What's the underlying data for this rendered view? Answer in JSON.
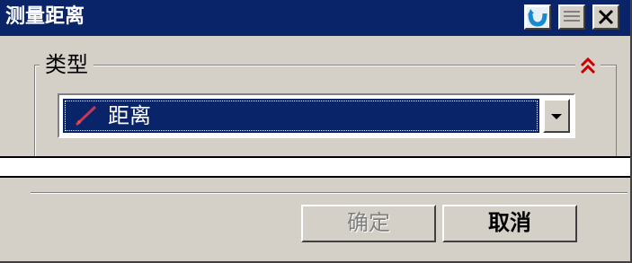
{
  "window": {
    "title": "测量距离",
    "colors": {
      "titlebar": "#0a246a",
      "face": "#d4d0c8",
      "selection": "#0a246a",
      "collapse_accent": "#cc0000"
    }
  },
  "titlebar_buttons": {
    "reset_icon": "reset-icon",
    "menu_icon": "menu-icon",
    "close_icon": "close-icon"
  },
  "type_group": {
    "label": "类型",
    "collapse_icon": "double-chevron-up-icon",
    "combo": {
      "selected": "距离",
      "icon": "measure-distance-icon",
      "dropdown_icon": "chevron-down-icon"
    }
  },
  "buttons": {
    "ok_label": "确定",
    "cancel_label": "取消"
  }
}
